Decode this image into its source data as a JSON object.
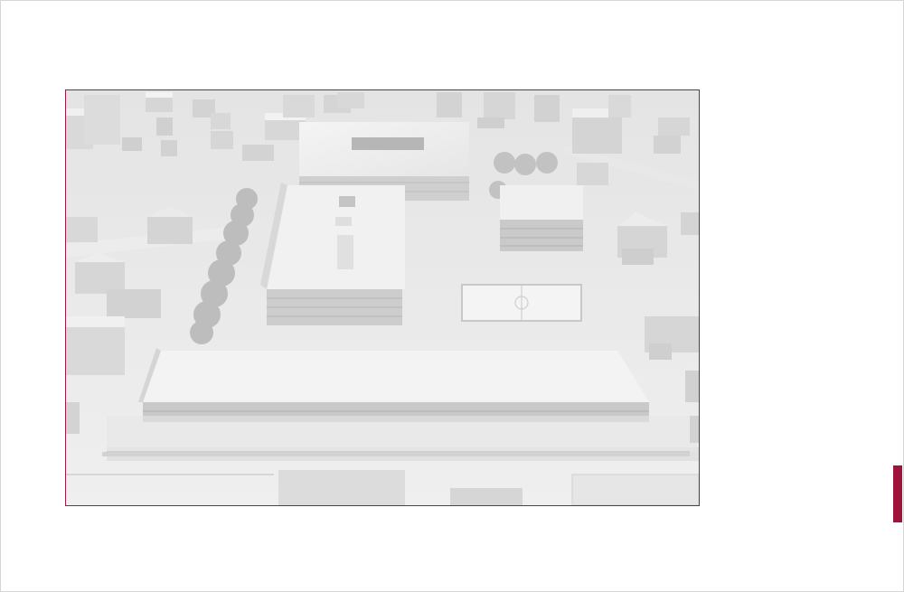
{
  "page": {
    "background": "#ffffff",
    "frame_border": "#d6d6d6"
  },
  "photo": {
    "subject": "",
    "border_color": "#9b1b42",
    "palette": [
      "#f2f2f2",
      "#e2e2e2",
      "#cfcfcf",
      "#b9b9b9",
      "#9e9e9e"
    ]
  },
  "accent_tab": {
    "color": "#a0143c"
  }
}
